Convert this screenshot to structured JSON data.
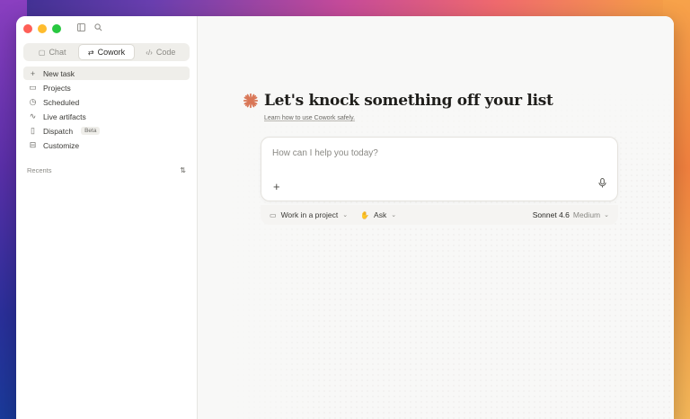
{
  "sidebar": {
    "tabs": [
      {
        "label": "Chat",
        "icon": "chat-bubble-icon"
      },
      {
        "label": "Cowork",
        "icon": "sliders-icon"
      },
      {
        "label": "Code",
        "icon": "code-icon"
      }
    ],
    "active_tab": "Cowork",
    "nav": [
      {
        "label": "New task",
        "icon": "plus-icon"
      },
      {
        "label": "Projects",
        "icon": "folder-icon"
      },
      {
        "label": "Scheduled",
        "icon": "clock-icon"
      },
      {
        "label": "Live artifacts",
        "icon": "pulse-icon"
      },
      {
        "label": "Dispatch",
        "icon": "phone-icon",
        "badge": "Beta"
      },
      {
        "label": "Customize",
        "icon": "briefcase-icon"
      }
    ],
    "recents_label": "Recents"
  },
  "main": {
    "headline": "Let's knock something off your list",
    "learn_link": "Learn how to use Cowork safely.",
    "composer": {
      "placeholder": "How can I help you today?"
    },
    "project_label": "Work in a project",
    "ask_label": "Ask",
    "model_name": "Sonnet 4.6",
    "model_level": "Medium"
  },
  "colors": {
    "accent": "#d97757",
    "traffic_red": "#fe5f57",
    "traffic_yellow": "#febc2e",
    "traffic_green": "#28c840"
  }
}
